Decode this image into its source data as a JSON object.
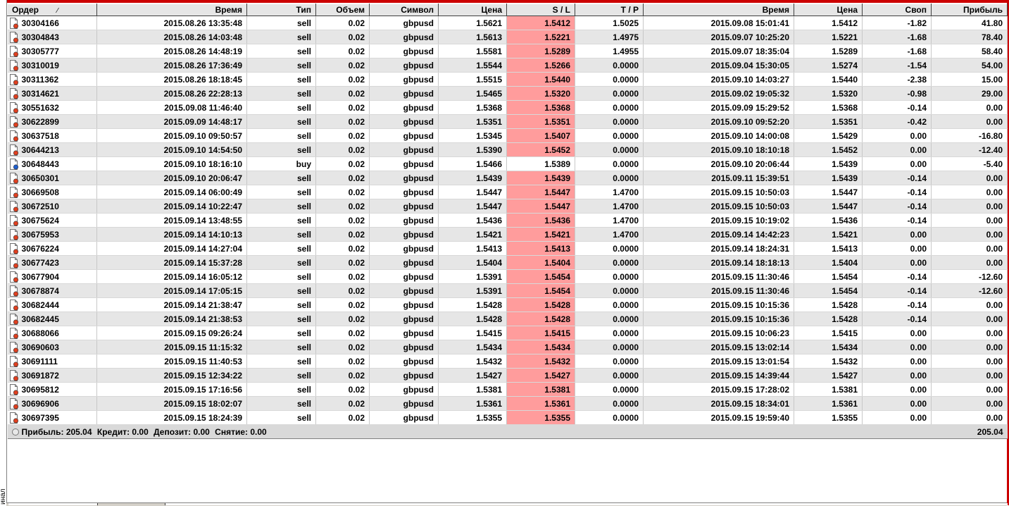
{
  "columns": {
    "order": "Ордер",
    "open_time": "Время",
    "type": "Тип",
    "volume": "Объем",
    "symbol": "Символ",
    "open_price": "Цена",
    "sl": "S / L",
    "tp": "T / P",
    "close_time": "Время",
    "close_price": "Цена",
    "swap": "Своп",
    "profit": "Прибыль",
    "sort_indicator": "⁄"
  },
  "rows": [
    {
      "order": "30304166",
      "open_time": "2015.08.26 13:35:48",
      "type": "sell",
      "volume": "0.02",
      "symbol": "gbpusd",
      "open_price": "1.5621",
      "sl": "1.5412",
      "sl_hit": true,
      "tp": "1.5025",
      "close_time": "2015.09.08 15:01:41",
      "close_price": "1.5412",
      "swap": "-1.82",
      "profit": "41.80"
    },
    {
      "order": "30304843",
      "open_time": "2015.08.26 14:03:48",
      "type": "sell",
      "volume": "0.02",
      "symbol": "gbpusd",
      "open_price": "1.5613",
      "sl": "1.5221",
      "sl_hit": true,
      "tp": "1.4975",
      "close_time": "2015.09.07 10:25:20",
      "close_price": "1.5221",
      "swap": "-1.68",
      "profit": "78.40"
    },
    {
      "order": "30305777",
      "open_time": "2015.08.26 14:48:19",
      "type": "sell",
      "volume": "0.02",
      "symbol": "gbpusd",
      "open_price": "1.5581",
      "sl": "1.5289",
      "sl_hit": true,
      "tp": "1.4955",
      "close_time": "2015.09.07 18:35:04",
      "close_price": "1.5289",
      "swap": "-1.68",
      "profit": "58.40"
    },
    {
      "order": "30310019",
      "open_time": "2015.08.26 17:36:49",
      "type": "sell",
      "volume": "0.02",
      "symbol": "gbpusd",
      "open_price": "1.5544",
      "sl": "1.5266",
      "sl_hit": true,
      "tp": "0.0000",
      "close_time": "2015.09.04 15:30:05",
      "close_price": "1.5274",
      "swap": "-1.54",
      "profit": "54.00"
    },
    {
      "order": "30311362",
      "open_time": "2015.08.26 18:18:45",
      "type": "sell",
      "volume": "0.02",
      "symbol": "gbpusd",
      "open_price": "1.5515",
      "sl": "1.5440",
      "sl_hit": true,
      "tp": "0.0000",
      "close_time": "2015.09.10 14:03:27",
      "close_price": "1.5440",
      "swap": "-2.38",
      "profit": "15.00"
    },
    {
      "order": "30314621",
      "open_time": "2015.08.26 22:28:13",
      "type": "sell",
      "volume": "0.02",
      "symbol": "gbpusd",
      "open_price": "1.5465",
      "sl": "1.5320",
      "sl_hit": true,
      "tp": "0.0000",
      "close_time": "2015.09.02 19:05:32",
      "close_price": "1.5320",
      "swap": "-0.98",
      "profit": "29.00"
    },
    {
      "order": "30551632",
      "open_time": "2015.09.08 11:46:40",
      "type": "sell",
      "volume": "0.02",
      "symbol": "gbpusd",
      "open_price": "1.5368",
      "sl": "1.5368",
      "sl_hit": true,
      "tp": "0.0000",
      "close_time": "2015.09.09 15:29:52",
      "close_price": "1.5368",
      "swap": "-0.14",
      "profit": "0.00"
    },
    {
      "order": "30622899",
      "open_time": "2015.09.09 14:48:17",
      "type": "sell",
      "volume": "0.02",
      "symbol": "gbpusd",
      "open_price": "1.5351",
      "sl": "1.5351",
      "sl_hit": true,
      "tp": "0.0000",
      "close_time": "2015.09.10 09:52:20",
      "close_price": "1.5351",
      "swap": "-0.42",
      "profit": "0.00"
    },
    {
      "order": "30637518",
      "open_time": "2015.09.10 09:50:57",
      "type": "sell",
      "volume": "0.02",
      "symbol": "gbpusd",
      "open_price": "1.5345",
      "sl": "1.5407",
      "sl_hit": true,
      "tp": "0.0000",
      "close_time": "2015.09.10 14:00:08",
      "close_price": "1.5429",
      "swap": "0.00",
      "profit": "-16.80"
    },
    {
      "order": "30644213",
      "open_time": "2015.09.10 14:54:50",
      "type": "sell",
      "volume": "0.02",
      "symbol": "gbpusd",
      "open_price": "1.5390",
      "sl": "1.5452",
      "sl_hit": true,
      "tp": "0.0000",
      "close_time": "2015.09.10 18:10:18",
      "close_price": "1.5452",
      "swap": "0.00",
      "profit": "-12.40"
    },
    {
      "order": "30648443",
      "open_time": "2015.09.10 18:16:10",
      "type": "buy",
      "volume": "0.02",
      "symbol": "gbpusd",
      "open_price": "1.5466",
      "sl": "1.5389",
      "sl_hit": false,
      "tp": "0.0000",
      "close_time": "2015.09.10 20:06:44",
      "close_price": "1.5439",
      "swap": "0.00",
      "profit": "-5.40"
    },
    {
      "order": "30650301",
      "open_time": "2015.09.10 20:06:47",
      "type": "sell",
      "volume": "0.02",
      "symbol": "gbpusd",
      "open_price": "1.5439",
      "sl": "1.5439",
      "sl_hit": true,
      "tp": "0.0000",
      "close_time": "2015.09.11 15:39:51",
      "close_price": "1.5439",
      "swap": "-0.14",
      "profit": "0.00"
    },
    {
      "order": "30669508",
      "open_time": "2015.09.14 06:00:49",
      "type": "sell",
      "volume": "0.02",
      "symbol": "gbpusd",
      "open_price": "1.5447",
      "sl": "1.5447",
      "sl_hit": true,
      "tp": "1.4700",
      "close_time": "2015.09.15 10:50:03",
      "close_price": "1.5447",
      "swap": "-0.14",
      "profit": "0.00"
    },
    {
      "order": "30672510",
      "open_time": "2015.09.14 10:22:47",
      "type": "sell",
      "volume": "0.02",
      "symbol": "gbpusd",
      "open_price": "1.5447",
      "sl": "1.5447",
      "sl_hit": true,
      "tp": "1.4700",
      "close_time": "2015.09.15 10:50:03",
      "close_price": "1.5447",
      "swap": "-0.14",
      "profit": "0.00"
    },
    {
      "order": "30675624",
      "open_time": "2015.09.14 13:48:55",
      "type": "sell",
      "volume": "0.02",
      "symbol": "gbpusd",
      "open_price": "1.5436",
      "sl": "1.5436",
      "sl_hit": true,
      "tp": "1.4700",
      "close_time": "2015.09.15 10:19:02",
      "close_price": "1.5436",
      "swap": "-0.14",
      "profit": "0.00"
    },
    {
      "order": "30675953",
      "open_time": "2015.09.14 14:10:13",
      "type": "sell",
      "volume": "0.02",
      "symbol": "gbpusd",
      "open_price": "1.5421",
      "sl": "1.5421",
      "sl_hit": true,
      "tp": "1.4700",
      "close_time": "2015.09.14 14:42:23",
      "close_price": "1.5421",
      "swap": "0.00",
      "profit": "0.00"
    },
    {
      "order": "30676224",
      "open_time": "2015.09.14 14:27:04",
      "type": "sell",
      "volume": "0.02",
      "symbol": "gbpusd",
      "open_price": "1.5413",
      "sl": "1.5413",
      "sl_hit": true,
      "tp": "0.0000",
      "close_time": "2015.09.14 18:24:31",
      "close_price": "1.5413",
      "swap": "0.00",
      "profit": "0.00"
    },
    {
      "order": "30677423",
      "open_time": "2015.09.14 15:37:28",
      "type": "sell",
      "volume": "0.02",
      "symbol": "gbpusd",
      "open_price": "1.5404",
      "sl": "1.5404",
      "sl_hit": true,
      "tp": "0.0000",
      "close_time": "2015.09.14 18:18:13",
      "close_price": "1.5404",
      "swap": "0.00",
      "profit": "0.00"
    },
    {
      "order": "30677904",
      "open_time": "2015.09.14 16:05:12",
      "type": "sell",
      "volume": "0.02",
      "symbol": "gbpusd",
      "open_price": "1.5391",
      "sl": "1.5454",
      "sl_hit": true,
      "tp": "0.0000",
      "close_time": "2015.09.15 11:30:46",
      "close_price": "1.5454",
      "swap": "-0.14",
      "profit": "-12.60"
    },
    {
      "order": "30678874",
      "open_time": "2015.09.14 17:05:15",
      "type": "sell",
      "volume": "0.02",
      "symbol": "gbpusd",
      "open_price": "1.5391",
      "sl": "1.5454",
      "sl_hit": true,
      "tp": "0.0000",
      "close_time": "2015.09.15 11:30:46",
      "close_price": "1.5454",
      "swap": "-0.14",
      "profit": "-12.60"
    },
    {
      "order": "30682444",
      "open_time": "2015.09.14 21:38:47",
      "type": "sell",
      "volume": "0.02",
      "symbol": "gbpusd",
      "open_price": "1.5428",
      "sl": "1.5428",
      "sl_hit": true,
      "tp": "0.0000",
      "close_time": "2015.09.15 10:15:36",
      "close_price": "1.5428",
      "swap": "-0.14",
      "profit": "0.00"
    },
    {
      "order": "30682445",
      "open_time": "2015.09.14 21:38:53",
      "type": "sell",
      "volume": "0.02",
      "symbol": "gbpusd",
      "open_price": "1.5428",
      "sl": "1.5428",
      "sl_hit": true,
      "tp": "0.0000",
      "close_time": "2015.09.15 10:15:36",
      "close_price": "1.5428",
      "swap": "-0.14",
      "profit": "0.00"
    },
    {
      "order": "30688066",
      "open_time": "2015.09.15 09:26:24",
      "type": "sell",
      "volume": "0.02",
      "symbol": "gbpusd",
      "open_price": "1.5415",
      "sl": "1.5415",
      "sl_hit": true,
      "tp": "0.0000",
      "close_time": "2015.09.15 10:06:23",
      "close_price": "1.5415",
      "swap": "0.00",
      "profit": "0.00"
    },
    {
      "order": "30690603",
      "open_time": "2015.09.15 11:15:32",
      "type": "sell",
      "volume": "0.02",
      "symbol": "gbpusd",
      "open_price": "1.5434",
      "sl": "1.5434",
      "sl_hit": true,
      "tp": "0.0000",
      "close_time": "2015.09.15 13:02:14",
      "close_price": "1.5434",
      "swap": "0.00",
      "profit": "0.00"
    },
    {
      "order": "30691111",
      "open_time": "2015.09.15 11:40:53",
      "type": "sell",
      "volume": "0.02",
      "symbol": "gbpusd",
      "open_price": "1.5432",
      "sl": "1.5432",
      "sl_hit": true,
      "tp": "0.0000",
      "close_time": "2015.09.15 13:01:54",
      "close_price": "1.5432",
      "swap": "0.00",
      "profit": "0.00"
    },
    {
      "order": "30691872",
      "open_time": "2015.09.15 12:34:22",
      "type": "sell",
      "volume": "0.02",
      "symbol": "gbpusd",
      "open_price": "1.5427",
      "sl": "1.5427",
      "sl_hit": true,
      "tp": "0.0000",
      "close_time": "2015.09.15 14:39:44",
      "close_price": "1.5427",
      "swap": "0.00",
      "profit": "0.00"
    },
    {
      "order": "30695812",
      "open_time": "2015.09.15 17:16:56",
      "type": "sell",
      "volume": "0.02",
      "symbol": "gbpusd",
      "open_price": "1.5381",
      "sl": "1.5381",
      "sl_hit": true,
      "tp": "0.0000",
      "close_time": "2015.09.15 17:28:02",
      "close_price": "1.5381",
      "swap": "0.00",
      "profit": "0.00"
    },
    {
      "order": "30696906",
      "open_time": "2015.09.15 18:02:07",
      "type": "sell",
      "volume": "0.02",
      "symbol": "gbpusd",
      "open_price": "1.5361",
      "sl": "1.5361",
      "sl_hit": true,
      "tp": "0.0000",
      "close_time": "2015.09.15 18:34:01",
      "close_price": "1.5361",
      "swap": "0.00",
      "profit": "0.00"
    },
    {
      "order": "30697395",
      "open_time": "2015.09.15 18:24:39",
      "type": "sell",
      "volume": "0.02",
      "symbol": "gbpusd",
      "open_price": "1.5355",
      "sl": "1.5355",
      "sl_hit": true,
      "tp": "0.0000",
      "close_time": "2015.09.15 19:59:40",
      "close_price": "1.5355",
      "swap": "0.00",
      "profit": "0.00"
    }
  ],
  "summary": {
    "profit_label": "Прибыль: 205.04",
    "credit_label": "Кредит: 0.00",
    "deposit_label": "Депозит: 0.00",
    "withdrawal_label": "Снятие: 0.00",
    "total": "205.04"
  },
  "side_label": "инал",
  "colors": {
    "sl_highlight": "#ff9c9c",
    "frame": "#cc0000",
    "sell_icon": "#e04020",
    "buy_icon": "#2060d0"
  },
  "icons": {
    "sell": "sell-order-icon",
    "buy": "buy-order-icon"
  }
}
